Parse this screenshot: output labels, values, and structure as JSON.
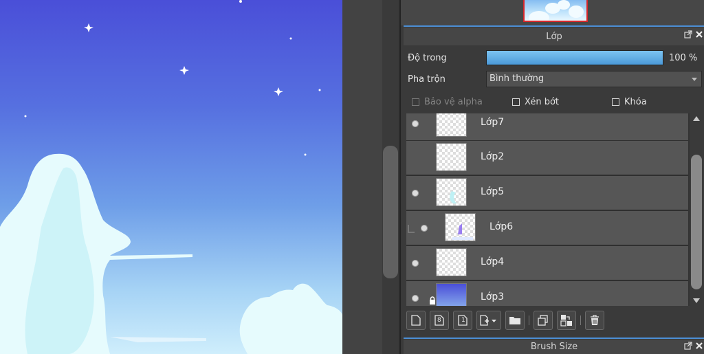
{
  "colors": {
    "accent": "#4c8fd6",
    "selection": "#d7262a"
  },
  "layer_panel": {
    "title": "Lớp",
    "opacity_label": "Độ trong",
    "opacity_fraction": 1.0,
    "opacity_value": "100 %",
    "blend_label": "Pha trộn",
    "blend_value": "Bình thường",
    "protect_alpha_label": "Bảo vệ alpha",
    "clipping_label": "Xén bớt",
    "lock_label": "Khóa",
    "header_icons": [
      "detach-icon",
      "close-icon"
    ],
    "layers": [
      {
        "name": "Lớp7",
        "visible": true
      },
      {
        "name": "Lớp2",
        "visible": false
      },
      {
        "name": "Lớp5",
        "visible": true
      },
      {
        "name": "Lớp6",
        "visible": true,
        "clipped": true
      },
      {
        "name": "Lớp4",
        "visible": true
      },
      {
        "name": "Lớp3",
        "visible": true,
        "locked": true
      }
    ],
    "toolbar_icons": [
      "new-layer-icon",
      "new-8bit-layer-icon",
      "new-1bit-layer-icon",
      "add-layer-dropdown-icon",
      "folder-icon",
      "duplicate-icon",
      "merge-down-icon",
      "delete-icon"
    ],
    "toolbar_glyphs": {
      "eight": "8",
      "one": "1"
    }
  },
  "brush_panel": {
    "title": "Brush Size"
  }
}
